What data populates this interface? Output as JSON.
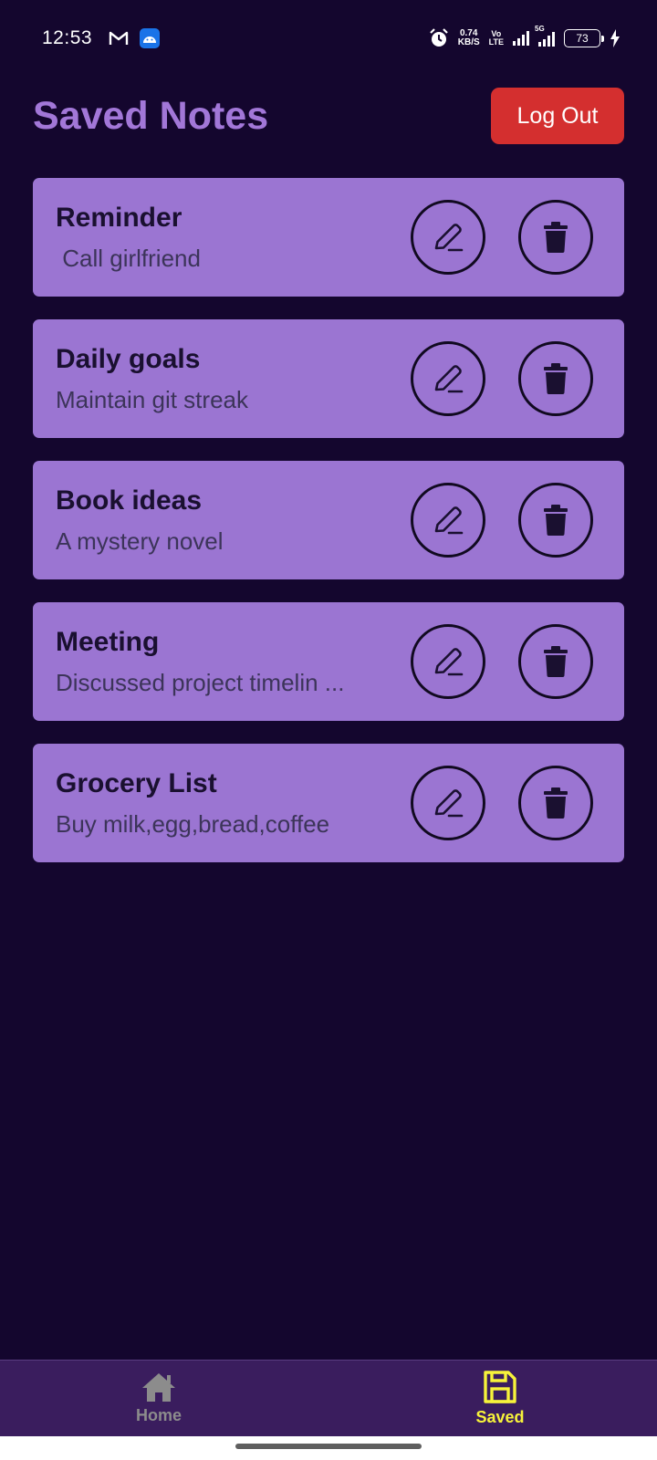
{
  "status_bar": {
    "time": "12:53",
    "net_speed_value": "0.74",
    "net_speed_unit": "KB/S",
    "volte_top": "Vo",
    "volte_bottom": "LTE",
    "network_5g": "5G",
    "battery_level": "73",
    "notification_icons": [
      "gmail-icon",
      "android-app-icon"
    ],
    "right_icons": [
      "alarm-icon",
      "signal-icon",
      "signal-5g-icon",
      "battery-icon",
      "charging-icon"
    ]
  },
  "header": {
    "title": "Saved Notes",
    "logout_label": "Log Out"
  },
  "notes": [
    {
      "title": "Reminder",
      "body": " Call girlfriend"
    },
    {
      "title": "Daily goals",
      "body": "Maintain git streak"
    },
    {
      "title": "Book ideas",
      "body": "A mystery novel"
    },
    {
      "title": "Meeting",
      "body": "Discussed project timelin ..."
    },
    {
      "title": "Grocery List",
      "body": "Buy milk,egg,bread,coffee"
    }
  ],
  "note_actions": {
    "edit_icon": "edit-pencil-icon",
    "delete_icon": "trash-icon"
  },
  "bottom_nav": {
    "items": [
      {
        "label": "Home",
        "icon": "home-icon",
        "active": false
      },
      {
        "label": "Saved",
        "icon": "save-floppy-icon",
        "active": true
      }
    ]
  },
  "colors": {
    "background": "#14062e",
    "title": "#a277d8",
    "card": "#9b75d2",
    "logout": "#d42f2f",
    "nav_bg": "#3a1d5e",
    "nav_active": "#f7f33a",
    "nav_inactive": "#8c8c8c"
  }
}
